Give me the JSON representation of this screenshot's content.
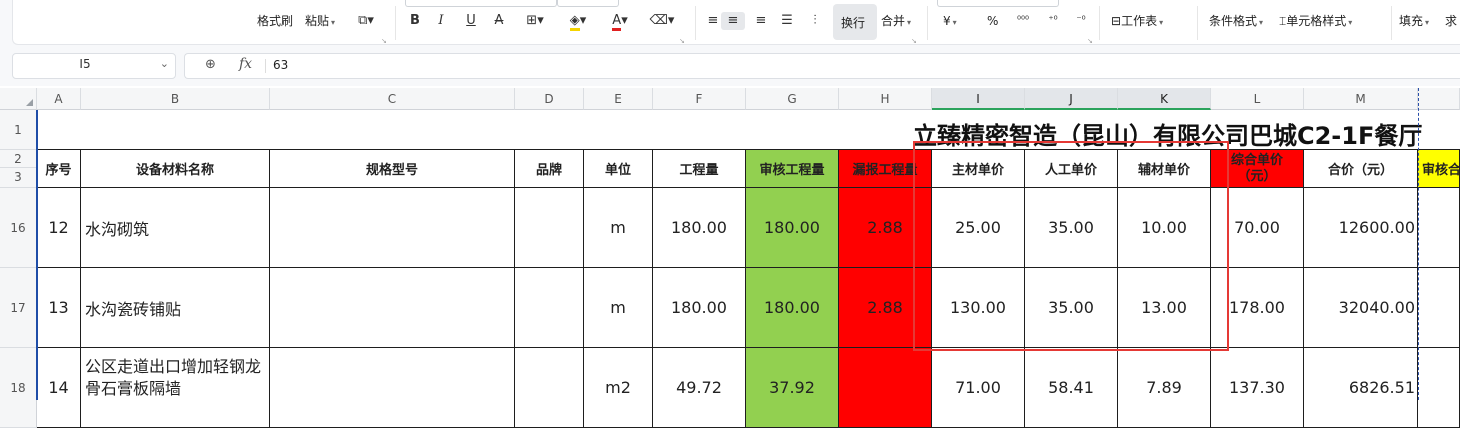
{
  "toolbar": {
    "format_painter": "格式刷",
    "paste": "粘贴",
    "wrap_text": "换行",
    "merge": "合并",
    "currency_symbol": "¥",
    "percent_symbol": "%",
    "worksheet": "工作表",
    "conditional_format": "条件格式",
    "cell_style": "单元格样式",
    "fill": "填充",
    "sum_partial": "求",
    "font_color_accent": "#e02020",
    "fill_color_accent": "#f5d400"
  },
  "formula_bar": {
    "name_box": "I5",
    "fx": "fx",
    "value": "63"
  },
  "columns": [
    "A",
    "B",
    "C",
    "D",
    "E",
    "F",
    "G",
    "H",
    "I",
    "J",
    "K",
    "L",
    "M"
  ],
  "title": "立臻精密智造（昆山）有限公司巴城C2-1F餐厅",
  "headers": {
    "seq": "序号",
    "name": "设备材料名称",
    "spec": "规格型号",
    "brand": "品牌",
    "unit": "单位",
    "quantity": "工程量",
    "audit_quantity": "审核工程量",
    "missed_quantity": "漏报工程量",
    "main_price": "主材单价",
    "labor_price": "人工单价",
    "aux_price": "辅材单价",
    "combined_price_line1": "综合单价",
    "combined_price_line2": "（元）",
    "total": "合价（元）",
    "audit_partial": "审核合"
  },
  "rows": [
    {
      "row_num": "1"
    },
    {
      "row_num": "2"
    },
    {
      "row_num": "3"
    },
    {
      "row_num": "16",
      "seq": "12",
      "name": "水沟砌筑",
      "spec": "",
      "brand": "",
      "unit": "m",
      "quantity": "180.00",
      "audit_quantity": "180.00",
      "missed_quantity": "2.88",
      "main_price": "25.00",
      "labor_price": "35.00",
      "aux_price": "10.00",
      "combined_price": "70.00",
      "total": "12600.00"
    },
    {
      "row_num": "17",
      "seq": "13",
      "name": "水沟瓷砖铺贴",
      "spec": "",
      "brand": "",
      "unit": "m",
      "quantity": "180.00",
      "audit_quantity": "180.00",
      "missed_quantity": "2.88",
      "main_price": "130.00",
      "labor_price": "35.00",
      "aux_price": "13.00",
      "combined_price": "178.00",
      "total": "32040.00"
    },
    {
      "row_num": "18",
      "seq": "14",
      "name": "公区走道出口增加轻钢龙骨石膏板隔墙",
      "spec": "",
      "brand": "",
      "unit": "m2",
      "quantity": "49.72",
      "audit_quantity": "37.92",
      "missed_quantity": "",
      "main_price": "71.00",
      "labor_price": "58.41",
      "aux_price": "7.89",
      "combined_price": "137.30",
      "total": "6826.51"
    }
  ],
  "colors": {
    "green_fill": "#92d050",
    "red_fill": "#ff0000",
    "yellow_fill": "#ffff00",
    "highlight_box": "#e53935",
    "selection_accent": "#2ba35c"
  }
}
